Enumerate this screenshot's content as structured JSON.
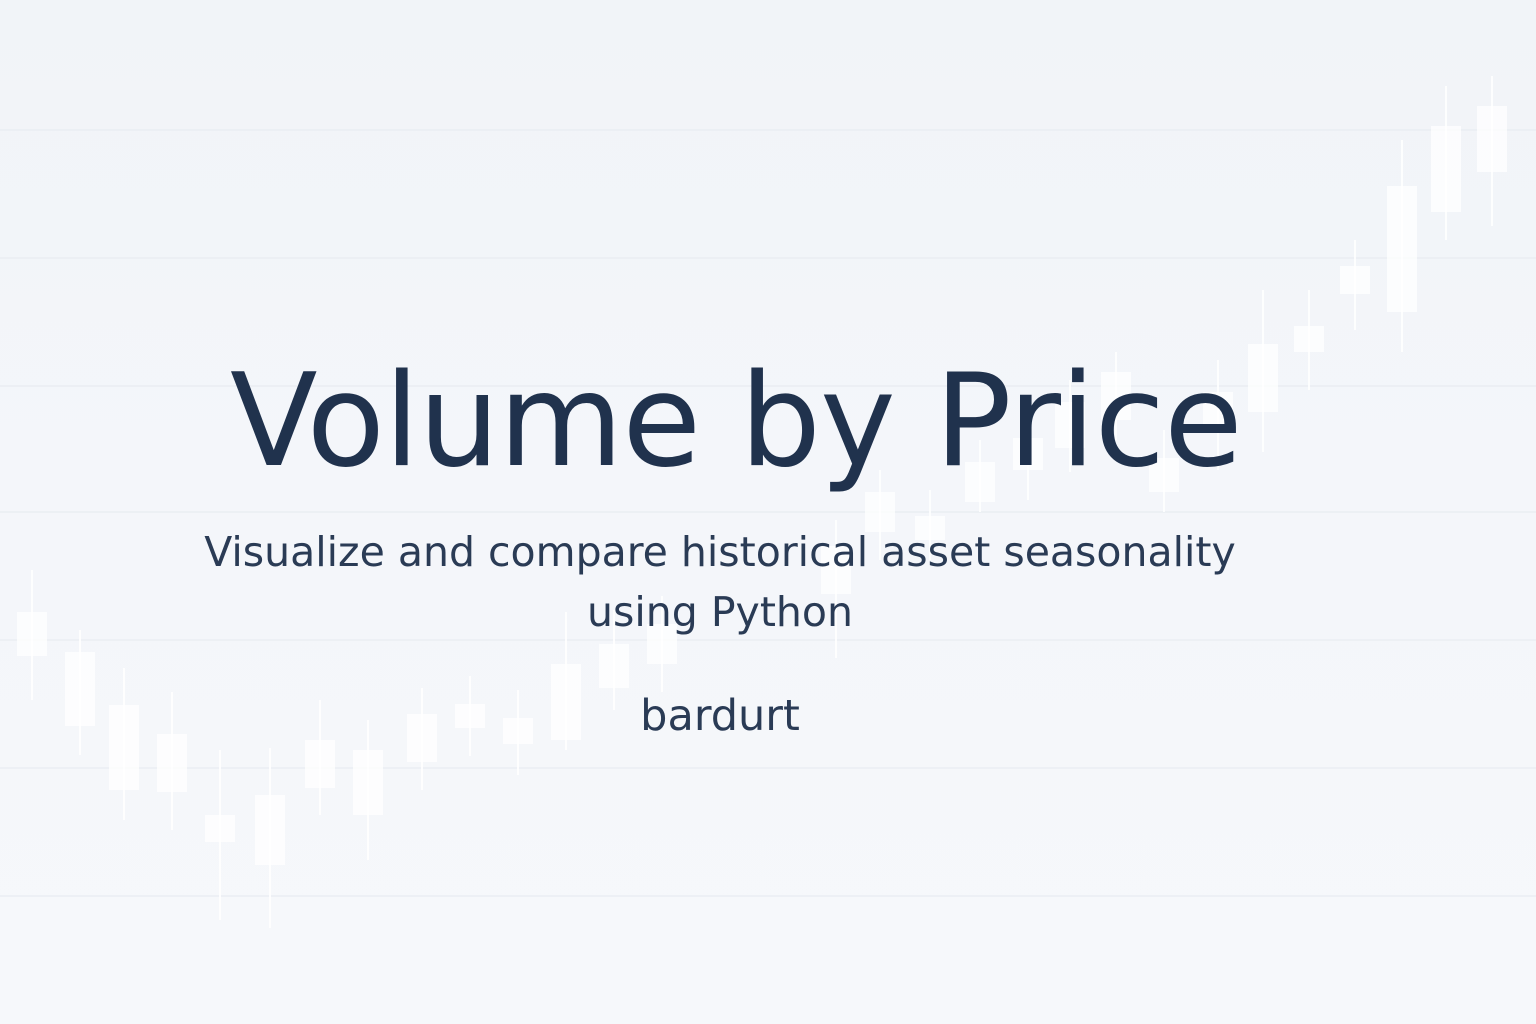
{
  "hero": {
    "title": "Volume by Price",
    "subtitle": "Visualize and compare historical asset seasonality using Python",
    "author": "bardurt"
  },
  "decor": {
    "description_icon": "candlestick-chart-watermark",
    "candle_color": "#ffffff",
    "grid_color": "#e6eaf0"
  }
}
